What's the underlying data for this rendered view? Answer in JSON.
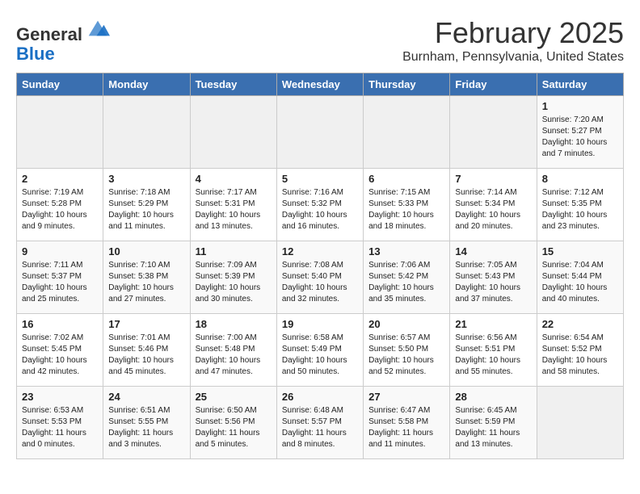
{
  "header": {
    "logo_line1": "General",
    "logo_line2": "Blue",
    "title": "February 2025",
    "subtitle": "Burnham, Pennsylvania, United States"
  },
  "weekdays": [
    "Sunday",
    "Monday",
    "Tuesday",
    "Wednesday",
    "Thursday",
    "Friday",
    "Saturday"
  ],
  "weeks": [
    [
      {
        "day": "",
        "info": ""
      },
      {
        "day": "",
        "info": ""
      },
      {
        "day": "",
        "info": ""
      },
      {
        "day": "",
        "info": ""
      },
      {
        "day": "",
        "info": ""
      },
      {
        "day": "",
        "info": ""
      },
      {
        "day": "1",
        "info": "Sunrise: 7:20 AM\nSunset: 5:27 PM\nDaylight: 10 hours\nand 7 minutes."
      }
    ],
    [
      {
        "day": "2",
        "info": "Sunrise: 7:19 AM\nSunset: 5:28 PM\nDaylight: 10 hours\nand 9 minutes."
      },
      {
        "day": "3",
        "info": "Sunrise: 7:18 AM\nSunset: 5:29 PM\nDaylight: 10 hours\nand 11 minutes."
      },
      {
        "day": "4",
        "info": "Sunrise: 7:17 AM\nSunset: 5:31 PM\nDaylight: 10 hours\nand 13 minutes."
      },
      {
        "day": "5",
        "info": "Sunrise: 7:16 AM\nSunset: 5:32 PM\nDaylight: 10 hours\nand 16 minutes."
      },
      {
        "day": "6",
        "info": "Sunrise: 7:15 AM\nSunset: 5:33 PM\nDaylight: 10 hours\nand 18 minutes."
      },
      {
        "day": "7",
        "info": "Sunrise: 7:14 AM\nSunset: 5:34 PM\nDaylight: 10 hours\nand 20 minutes."
      },
      {
        "day": "8",
        "info": "Sunrise: 7:12 AM\nSunset: 5:35 PM\nDaylight: 10 hours\nand 23 minutes."
      }
    ],
    [
      {
        "day": "9",
        "info": "Sunrise: 7:11 AM\nSunset: 5:37 PM\nDaylight: 10 hours\nand 25 minutes."
      },
      {
        "day": "10",
        "info": "Sunrise: 7:10 AM\nSunset: 5:38 PM\nDaylight: 10 hours\nand 27 minutes."
      },
      {
        "day": "11",
        "info": "Sunrise: 7:09 AM\nSunset: 5:39 PM\nDaylight: 10 hours\nand 30 minutes."
      },
      {
        "day": "12",
        "info": "Sunrise: 7:08 AM\nSunset: 5:40 PM\nDaylight: 10 hours\nand 32 minutes."
      },
      {
        "day": "13",
        "info": "Sunrise: 7:06 AM\nSunset: 5:42 PM\nDaylight: 10 hours\nand 35 minutes."
      },
      {
        "day": "14",
        "info": "Sunrise: 7:05 AM\nSunset: 5:43 PM\nDaylight: 10 hours\nand 37 minutes."
      },
      {
        "day": "15",
        "info": "Sunrise: 7:04 AM\nSunset: 5:44 PM\nDaylight: 10 hours\nand 40 minutes."
      }
    ],
    [
      {
        "day": "16",
        "info": "Sunrise: 7:02 AM\nSunset: 5:45 PM\nDaylight: 10 hours\nand 42 minutes."
      },
      {
        "day": "17",
        "info": "Sunrise: 7:01 AM\nSunset: 5:46 PM\nDaylight: 10 hours\nand 45 minutes."
      },
      {
        "day": "18",
        "info": "Sunrise: 7:00 AM\nSunset: 5:48 PM\nDaylight: 10 hours\nand 47 minutes."
      },
      {
        "day": "19",
        "info": "Sunrise: 6:58 AM\nSunset: 5:49 PM\nDaylight: 10 hours\nand 50 minutes."
      },
      {
        "day": "20",
        "info": "Sunrise: 6:57 AM\nSunset: 5:50 PM\nDaylight: 10 hours\nand 52 minutes."
      },
      {
        "day": "21",
        "info": "Sunrise: 6:56 AM\nSunset: 5:51 PM\nDaylight: 10 hours\nand 55 minutes."
      },
      {
        "day": "22",
        "info": "Sunrise: 6:54 AM\nSunset: 5:52 PM\nDaylight: 10 hours\nand 58 minutes."
      }
    ],
    [
      {
        "day": "23",
        "info": "Sunrise: 6:53 AM\nSunset: 5:53 PM\nDaylight: 11 hours\nand 0 minutes."
      },
      {
        "day": "24",
        "info": "Sunrise: 6:51 AM\nSunset: 5:55 PM\nDaylight: 11 hours\nand 3 minutes."
      },
      {
        "day": "25",
        "info": "Sunrise: 6:50 AM\nSunset: 5:56 PM\nDaylight: 11 hours\nand 5 minutes."
      },
      {
        "day": "26",
        "info": "Sunrise: 6:48 AM\nSunset: 5:57 PM\nDaylight: 11 hours\nand 8 minutes."
      },
      {
        "day": "27",
        "info": "Sunrise: 6:47 AM\nSunset: 5:58 PM\nDaylight: 11 hours\nand 11 minutes."
      },
      {
        "day": "28",
        "info": "Sunrise: 6:45 AM\nSunset: 5:59 PM\nDaylight: 11 hours\nand 13 minutes."
      },
      {
        "day": "",
        "info": ""
      }
    ]
  ]
}
